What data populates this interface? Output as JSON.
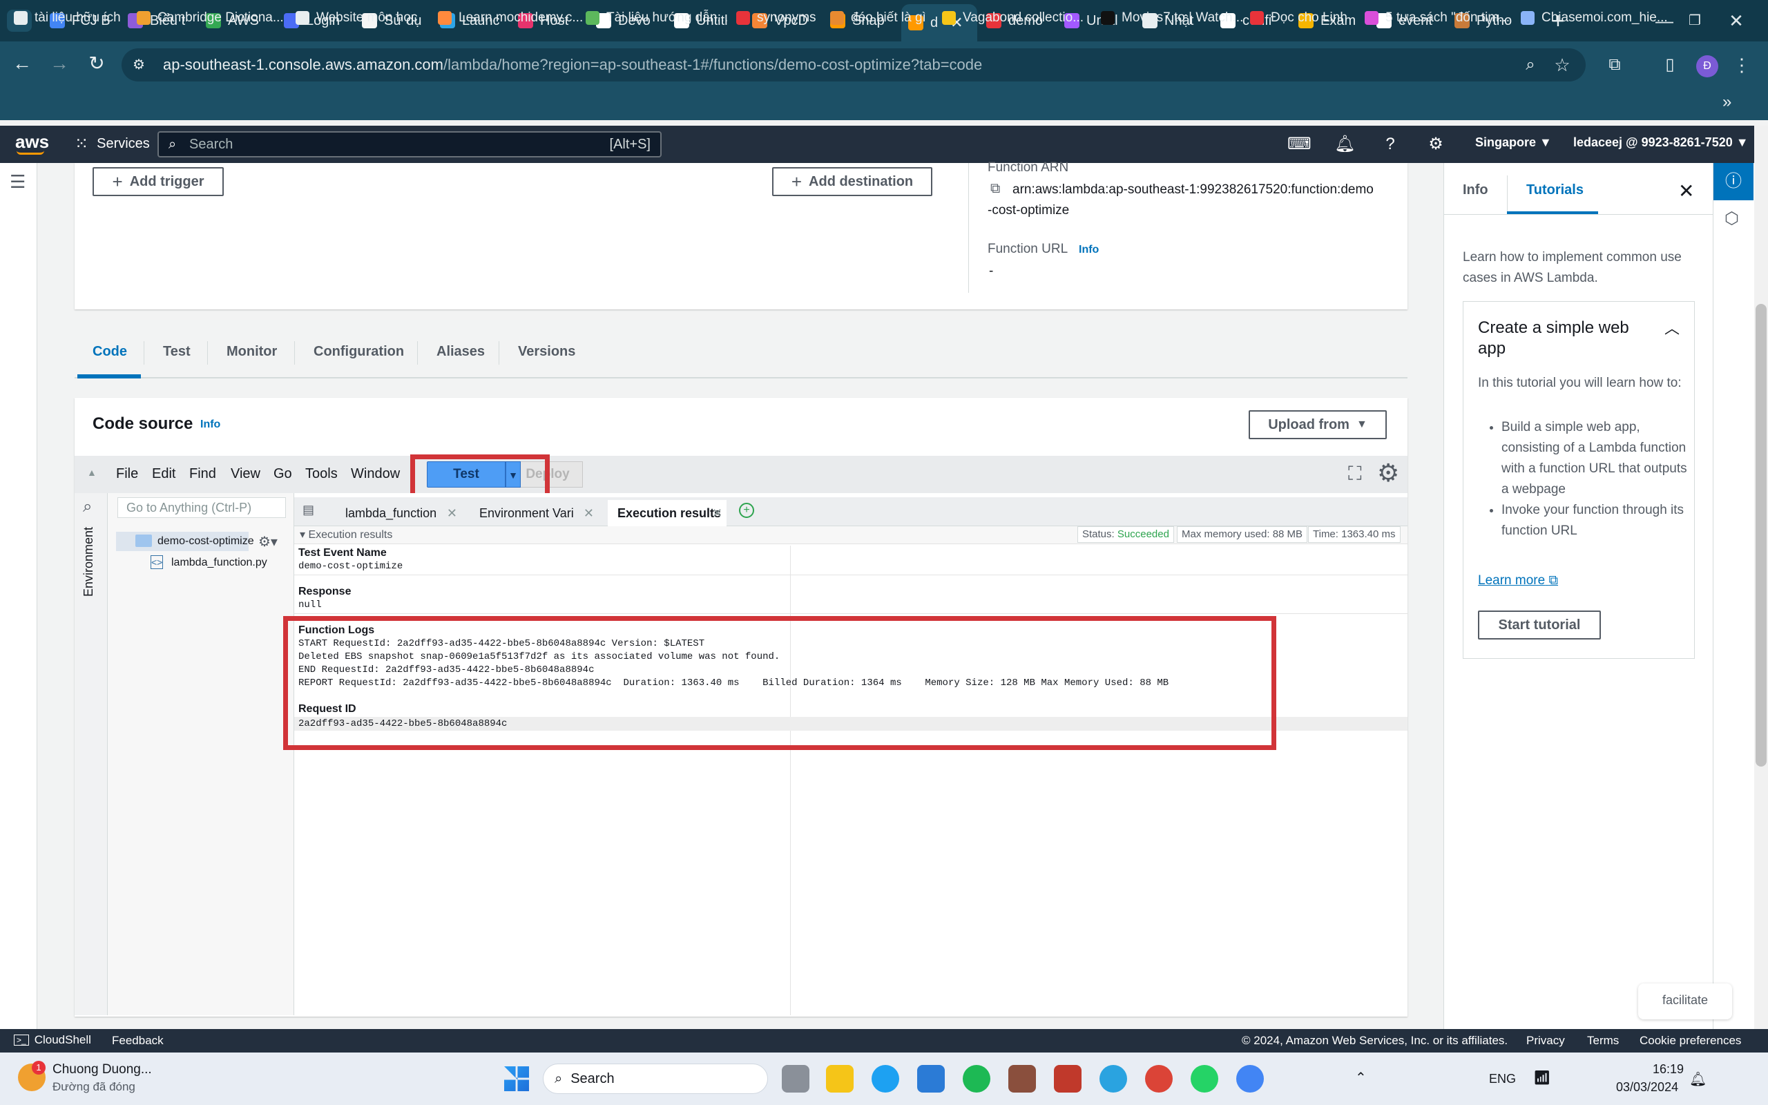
{
  "browser": {
    "tabs": [
      {
        "label": "FCJ B",
        "color": "#4285f4"
      },
      {
        "label": "Biểu t",
        "color": "#8e5cd9"
      },
      {
        "label": "AWS",
        "color": "#34a853"
      },
      {
        "label": "Login",
        "color": "#4b6cf5"
      },
      {
        "label": "Sử dụ",
        "color": "#f5f5f5"
      },
      {
        "label": "Launc",
        "color": "#2ea5e8"
      },
      {
        "label": "Host",
        "color": "#e8336d"
      },
      {
        "label": "Devo",
        "color": "#ffffff"
      },
      {
        "label": "Untitl",
        "color": "#ffffff"
      },
      {
        "label": "VpcD",
        "color": "#f58536"
      },
      {
        "label": "Snap",
        "color": "#ff9900"
      },
      {
        "label": "d",
        "color": "#ff9900"
      },
      {
        "label": "demo",
        "color": "#e8333a"
      },
      {
        "label": "Untitl",
        "color": "#a259ff"
      },
      {
        "label": "Nhật",
        "color": "#e8eef0"
      },
      {
        "label": "confi",
        "color": "#ffffff"
      },
      {
        "label": "Exam",
        "color": "#f7b500"
      },
      {
        "label": "event",
        "color": "#ffffff"
      },
      {
        "label": "Pytho",
        "color": "#c97b3a"
      }
    ],
    "url_host": "ap-southeast-1.console.aws.amazon.com",
    "url_path": "/lambda/home?region=ap-southeast-1#/functions/demo-cost-optimize?tab=code",
    "profile_initial": "Đ",
    "bookmarks": [
      {
        "label": "tài liệu hữu ích",
        "color": "#e8eef0"
      },
      {
        "label": "Cambridge Dictiona...",
        "color": "#f0a030"
      },
      {
        "label": "Website môn học",
        "color": "#e8eef0"
      },
      {
        "label": "Learn.mochidemy.c...",
        "color": "#ff8a3d"
      },
      {
        "label": "Tài liệu hướng dẫn...",
        "color": "#5cb85c"
      },
      {
        "label": "synonyms",
        "color": "#e8333a"
      },
      {
        "label": "đéo biết là gì",
        "color": "#e88a30"
      },
      {
        "label": "Vagabond collectio...",
        "color": "#f5c518"
      },
      {
        "label": "Movies7.to | Watch...",
        "color": "#111111"
      },
      {
        "label": "Đọc cho Linh",
        "color": "#e8333a"
      },
      {
        "label": "5 tựa sách \"đốn tim...",
        "color": "#d94fd9"
      },
      {
        "label": "Chiasemoi.com_hie...",
        "color": "#8ab4f8"
      }
    ]
  },
  "aws": {
    "logo": "aws",
    "services": "Services",
    "search_placeholder": "Search",
    "search_shortcut": "[Alt+S]",
    "region": "Singapore ▼",
    "account": "ledaceej @ 9923-8261-7520 ▼"
  },
  "overview": {
    "add_trigger": "Add trigger",
    "add_destination": "Add destination",
    "arn_label": "Function ARN",
    "arn_value_1": "arn:aws:lambda:ap-southeast-1:992382617520:function:demo",
    "arn_value_2": "-cost-optimize",
    "url_label": "Function URL",
    "url_info": "Info",
    "url_value": "-"
  },
  "function_tabs": [
    "Code",
    "Test",
    "Monitor",
    "Configuration",
    "Aliases",
    "Versions"
  ],
  "code_source": {
    "title": "Code source",
    "info": "Info",
    "upload_from": "Upload from",
    "menu": [
      "File",
      "Edit",
      "Find",
      "View",
      "Go",
      "Tools",
      "Window"
    ],
    "test_btn": "Test",
    "deploy_btn": "Deploy",
    "goto_placeholder": "Go to Anything (Ctrl-P)",
    "environment_label": "Environment",
    "folder": "demo-cost-optimize",
    "file": "lambda_function.py",
    "editor_tabs": [
      "lambda_function",
      "Environment Vari",
      "Execution results"
    ],
    "exec_title": "Execution results",
    "status_label": "Status:",
    "status_value": "Succeeded",
    "max_memory": "Max memory used: 88 MB",
    "time": "Time: 1363.40 ms",
    "test_event_name_h": "Test Event Name",
    "test_event_name_v": "demo-cost-optimize",
    "response_h": "Response",
    "response_v": "null",
    "function_logs_h": "Function Logs",
    "log_lines": [
      "START RequestId: 2a2dff93-ad35-4422-bbe5-8b6048a8894c Version: $LATEST",
      "Deleted EBS snapshot snap-0609e1a5f513f7d2f as its associated volume was not found.",
      "END RequestId: 2a2dff93-ad35-4422-bbe5-8b6048a8894c",
      "REPORT RequestId: 2a2dff93-ad35-4422-bbe5-8b6048a8894c  Duration: 1363.40 ms    Billed Duration: 1364 ms    Memory Size: 128 MB Max Memory Used: 88 MB"
    ],
    "request_id_h": "Request ID",
    "request_id_v": "2a2dff93-ad35-4422-bbe5-8b6048a8894c"
  },
  "right_panel": {
    "tab_info": "Info",
    "tab_tutorials": "Tutorials",
    "intro": "Learn how to implement common use cases in AWS Lambda.",
    "card_title": "Create a simple web app",
    "card_intro": "In this tutorial you will learn how to:",
    "bullets": [
      "Build a simple web app, consisting of a Lambda function with a function URL that outputs a webpage",
      "Invoke your function through its function URL"
    ],
    "learn_more": "Learn more",
    "start_tutorial": "Start tutorial",
    "facilitate": "facilitate"
  },
  "footer": {
    "cloudshell": "CloudShell",
    "feedback": "Feedback",
    "copyright": "© 2024, Amazon Web Services, Inc. or its affiliates.",
    "privacy": "Privacy",
    "terms": "Terms",
    "cookies": "Cookie preferences"
  },
  "taskbar": {
    "notif_name": "Chuong Duong...",
    "notif_sub": "Đường đã đóng",
    "search": "Search",
    "lang": "ENG",
    "time": "16:19",
    "date": "03/03/2024"
  }
}
